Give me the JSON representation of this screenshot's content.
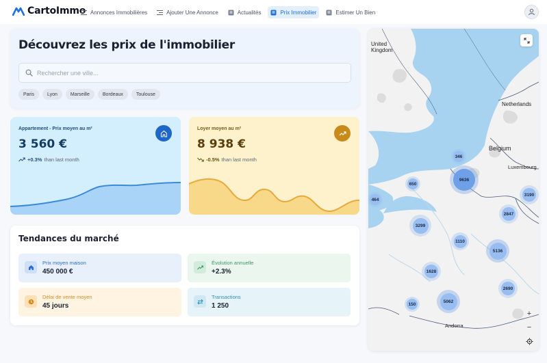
{
  "nav": {
    "brand": "CartoImmo",
    "items": [
      {
        "label": "Annonces Immobilières",
        "icon": "list-icon",
        "active": false
      },
      {
        "label": "Ajouter Une Annonce",
        "icon": "list-add-icon",
        "active": false
      },
      {
        "label": "Actualités",
        "icon": "news-icon",
        "active": false
      },
      {
        "label": "Prix Immobilier",
        "icon": "doc-icon",
        "active": true
      },
      {
        "label": "Estimer Un Bien",
        "icon": "calc-icon",
        "active": false
      }
    ],
    "avatar_icon": "user-icon"
  },
  "hero": {
    "title": "Découvrez les prix de l'immobilier",
    "search_placeholder": "Rechercher une ville...",
    "chips": [
      "Paris",
      "Lyon",
      "Marseille",
      "Bordeaux",
      "Toulouse"
    ]
  },
  "stats": {
    "apartment": {
      "title": "Appartement - Prix moyen au m²",
      "value": "3 560 €",
      "change": "+0.3%",
      "change_suffix": "than last month",
      "icon": "house-icon",
      "accent": "#1f66c9"
    },
    "rent": {
      "title": "Loyer moyen au m²",
      "value": "8 938 €",
      "change": "-0.5%",
      "change_suffix": "than last month",
      "icon": "trend-up-icon",
      "accent": "#c98a1c"
    }
  },
  "trends": {
    "title": "Tendances du marché",
    "cards": [
      {
        "label": "Prix moyen maison",
        "value": "450 000 €",
        "icon": "house-icon",
        "color": "#2a6dd0"
      },
      {
        "label": "Évolution annuelle",
        "value": "+2.3%",
        "icon": "trend-up-icon",
        "color": "#3b9a62"
      },
      {
        "label": "Délai de vente moyen",
        "value": "45 jours",
        "icon": "clock-icon",
        "color": "#d98c1d"
      },
      {
        "label": "Transactions",
        "value": "1 250",
        "icon": "swap-icon",
        "color": "#2d8fb5"
      }
    ]
  },
  "map": {
    "countries": [
      {
        "name": "United Kingdom"
      },
      {
        "name": "Netherlands"
      },
      {
        "name": "Belgium"
      },
      {
        "name": "Luxembourg"
      },
      {
        "name": "Andorra"
      }
    ],
    "clusters": [
      "346",
      "650",
      "9636",
      "464",
      "3190",
      "2847",
      "3299",
      "1110",
      "5136",
      "1628",
      "2690",
      "5062",
      "150"
    ],
    "controls": {
      "expand": "expand-icon",
      "zoom_in": "+",
      "zoom_out": "−",
      "locate": "locate-icon"
    }
  }
}
